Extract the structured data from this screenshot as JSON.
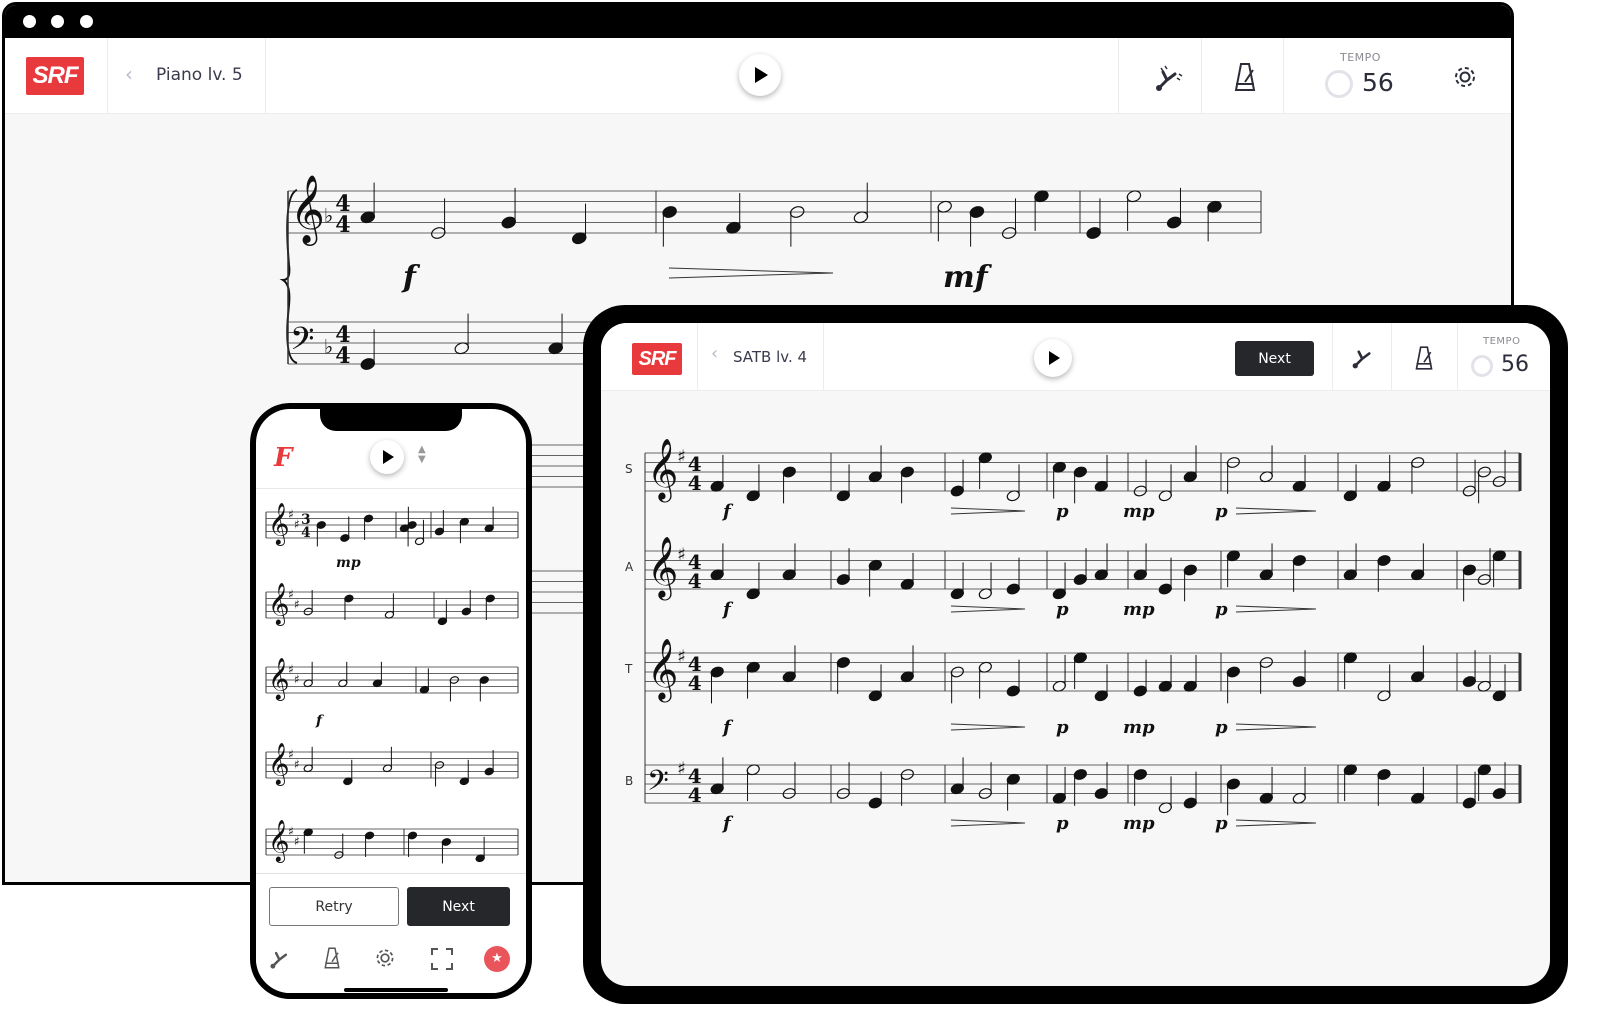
{
  "colors": {
    "brand": "#e8393d",
    "dark_button": "#26272b",
    "background": "#f7f7f7"
  },
  "desktop": {
    "logo": "SRF",
    "back_label": "Piano  lv. 5",
    "tempo_label": "TEMPO",
    "tempo_value": "56",
    "icons": [
      "play-icon",
      "tuning-fork-icon",
      "metronome-icon",
      "timer-icon",
      "gear-icon"
    ],
    "dynamics": [
      "f",
      "mf"
    ]
  },
  "tablet": {
    "logo": "SRF",
    "back_label": "SATB  lv. 4",
    "next_label": "Next",
    "tempo_label": "TEMPO",
    "tempo_value": "56",
    "voices": [
      {
        "label": "S",
        "dynamics": [
          "f",
          "p",
          "mp",
          "p"
        ]
      },
      {
        "label": "A",
        "dynamics": [
          "f",
          "p",
          "mp",
          "p"
        ]
      },
      {
        "label": "T",
        "dynamics": [
          "f",
          "p",
          "mp",
          "p"
        ]
      },
      {
        "label": "B",
        "dynamics": [
          "f",
          "p",
          "mp",
          "p"
        ]
      }
    ]
  },
  "phone": {
    "logo": "F",
    "retry_label": "Retry",
    "next_label": "Next",
    "dynamics": [
      "mp",
      "f"
    ],
    "icons": [
      "tuning-fork-icon",
      "metronome-icon",
      "gear-icon",
      "fullscreen-icon",
      "star-icon"
    ]
  }
}
